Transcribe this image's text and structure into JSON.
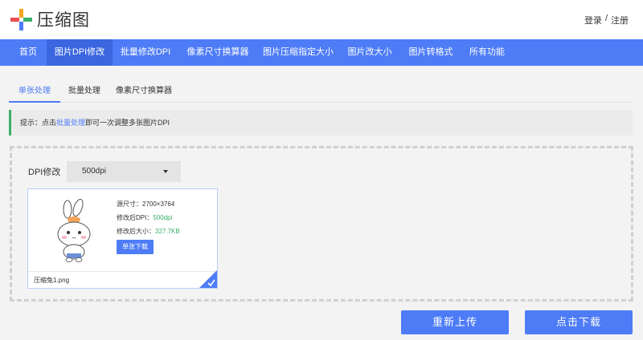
{
  "header": {
    "logo_text": "压缩图",
    "login": "登录",
    "separator": "/",
    "register": "注册"
  },
  "nav": {
    "items": [
      {
        "label": "首页"
      },
      {
        "label": "图片DPI修改"
      },
      {
        "label": "批量修改DPI"
      },
      {
        "label": "像素尺寸换算器"
      },
      {
        "label": "图片压缩指定大小"
      },
      {
        "label": "图片改大小"
      },
      {
        "label": "图片转格式"
      },
      {
        "label": "所有功能"
      }
    ],
    "active_index": 1
  },
  "tabs": [
    {
      "label": "单张处理"
    },
    {
      "label": "批量处理"
    },
    {
      "label": "像素尺寸换算器"
    }
  ],
  "tip": {
    "prefix": "提示：点击",
    "link": "批量处理",
    "suffix": "即可一次调整多张图片DPI"
  },
  "dpi": {
    "label": "DPI修改",
    "selected": "500dpi"
  },
  "card": {
    "original_size_label": "源尺寸：",
    "original_size_value": "2700×3764",
    "dpi_label": "修改后DPI：",
    "dpi_value": "500dpi",
    "size_label": "修改后大小：",
    "size_value": "327.7KB",
    "download_label": "单张下载",
    "filename": "压缩兔1.png"
  },
  "actions": {
    "reupload": "重新上传",
    "download": "点击下载"
  },
  "colors": {
    "primary": "#4e7cf6",
    "green": "#3bb06a"
  }
}
